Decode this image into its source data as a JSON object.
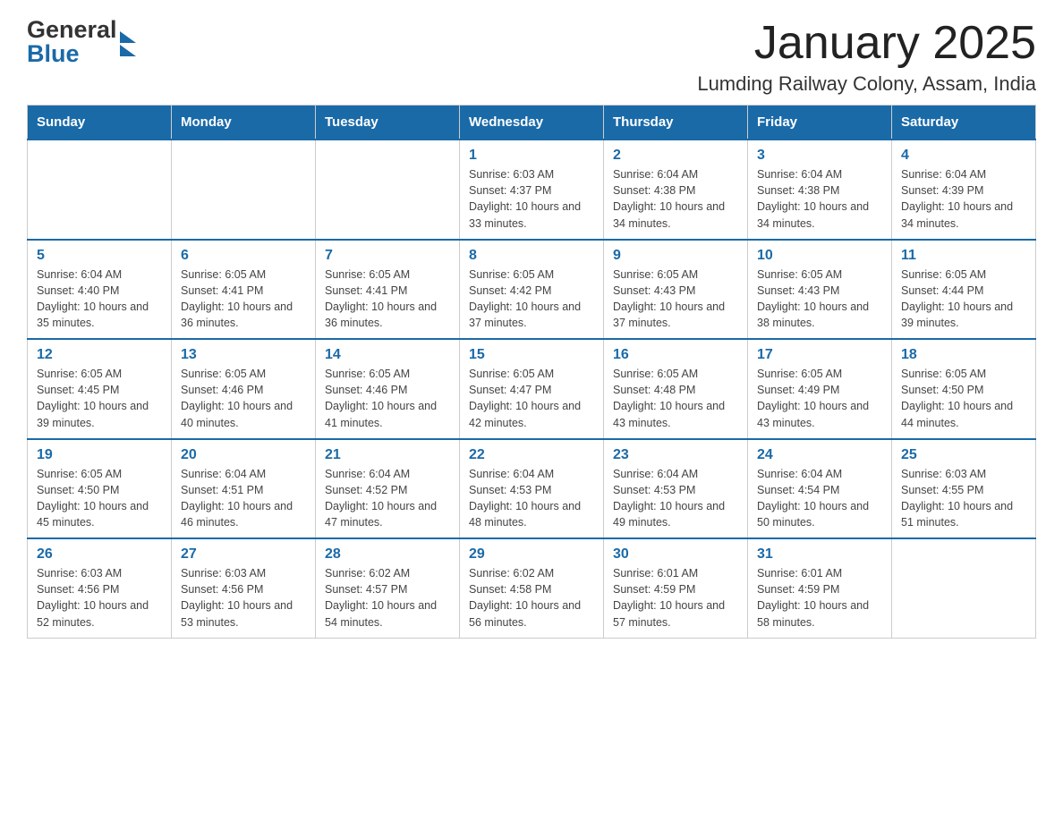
{
  "header": {
    "title": "January 2025",
    "subtitle": "Lumding Railway Colony, Assam, India",
    "logo_general": "General",
    "logo_blue": "Blue"
  },
  "days_of_week": [
    "Sunday",
    "Monday",
    "Tuesday",
    "Wednesday",
    "Thursday",
    "Friday",
    "Saturday"
  ],
  "weeks": [
    [
      {
        "day": "",
        "sunrise": "",
        "sunset": "",
        "daylight": ""
      },
      {
        "day": "",
        "sunrise": "",
        "sunset": "",
        "daylight": ""
      },
      {
        "day": "",
        "sunrise": "",
        "sunset": "",
        "daylight": ""
      },
      {
        "day": "1",
        "sunrise": "Sunrise: 6:03 AM",
        "sunset": "Sunset: 4:37 PM",
        "daylight": "Daylight: 10 hours and 33 minutes."
      },
      {
        "day": "2",
        "sunrise": "Sunrise: 6:04 AM",
        "sunset": "Sunset: 4:38 PM",
        "daylight": "Daylight: 10 hours and 34 minutes."
      },
      {
        "day": "3",
        "sunrise": "Sunrise: 6:04 AM",
        "sunset": "Sunset: 4:38 PM",
        "daylight": "Daylight: 10 hours and 34 minutes."
      },
      {
        "day": "4",
        "sunrise": "Sunrise: 6:04 AM",
        "sunset": "Sunset: 4:39 PM",
        "daylight": "Daylight: 10 hours and 34 minutes."
      }
    ],
    [
      {
        "day": "5",
        "sunrise": "Sunrise: 6:04 AM",
        "sunset": "Sunset: 4:40 PM",
        "daylight": "Daylight: 10 hours and 35 minutes."
      },
      {
        "day": "6",
        "sunrise": "Sunrise: 6:05 AM",
        "sunset": "Sunset: 4:41 PM",
        "daylight": "Daylight: 10 hours and 36 minutes."
      },
      {
        "day": "7",
        "sunrise": "Sunrise: 6:05 AM",
        "sunset": "Sunset: 4:41 PM",
        "daylight": "Daylight: 10 hours and 36 minutes."
      },
      {
        "day": "8",
        "sunrise": "Sunrise: 6:05 AM",
        "sunset": "Sunset: 4:42 PM",
        "daylight": "Daylight: 10 hours and 37 minutes."
      },
      {
        "day": "9",
        "sunrise": "Sunrise: 6:05 AM",
        "sunset": "Sunset: 4:43 PM",
        "daylight": "Daylight: 10 hours and 37 minutes."
      },
      {
        "day": "10",
        "sunrise": "Sunrise: 6:05 AM",
        "sunset": "Sunset: 4:43 PM",
        "daylight": "Daylight: 10 hours and 38 minutes."
      },
      {
        "day": "11",
        "sunrise": "Sunrise: 6:05 AM",
        "sunset": "Sunset: 4:44 PM",
        "daylight": "Daylight: 10 hours and 39 minutes."
      }
    ],
    [
      {
        "day": "12",
        "sunrise": "Sunrise: 6:05 AM",
        "sunset": "Sunset: 4:45 PM",
        "daylight": "Daylight: 10 hours and 39 minutes."
      },
      {
        "day": "13",
        "sunrise": "Sunrise: 6:05 AM",
        "sunset": "Sunset: 4:46 PM",
        "daylight": "Daylight: 10 hours and 40 minutes."
      },
      {
        "day": "14",
        "sunrise": "Sunrise: 6:05 AM",
        "sunset": "Sunset: 4:46 PM",
        "daylight": "Daylight: 10 hours and 41 minutes."
      },
      {
        "day": "15",
        "sunrise": "Sunrise: 6:05 AM",
        "sunset": "Sunset: 4:47 PM",
        "daylight": "Daylight: 10 hours and 42 minutes."
      },
      {
        "day": "16",
        "sunrise": "Sunrise: 6:05 AM",
        "sunset": "Sunset: 4:48 PM",
        "daylight": "Daylight: 10 hours and 43 minutes."
      },
      {
        "day": "17",
        "sunrise": "Sunrise: 6:05 AM",
        "sunset": "Sunset: 4:49 PM",
        "daylight": "Daylight: 10 hours and 43 minutes."
      },
      {
        "day": "18",
        "sunrise": "Sunrise: 6:05 AM",
        "sunset": "Sunset: 4:50 PM",
        "daylight": "Daylight: 10 hours and 44 minutes."
      }
    ],
    [
      {
        "day": "19",
        "sunrise": "Sunrise: 6:05 AM",
        "sunset": "Sunset: 4:50 PM",
        "daylight": "Daylight: 10 hours and 45 minutes."
      },
      {
        "day": "20",
        "sunrise": "Sunrise: 6:04 AM",
        "sunset": "Sunset: 4:51 PM",
        "daylight": "Daylight: 10 hours and 46 minutes."
      },
      {
        "day": "21",
        "sunrise": "Sunrise: 6:04 AM",
        "sunset": "Sunset: 4:52 PM",
        "daylight": "Daylight: 10 hours and 47 minutes."
      },
      {
        "day": "22",
        "sunrise": "Sunrise: 6:04 AM",
        "sunset": "Sunset: 4:53 PM",
        "daylight": "Daylight: 10 hours and 48 minutes."
      },
      {
        "day": "23",
        "sunrise": "Sunrise: 6:04 AM",
        "sunset": "Sunset: 4:53 PM",
        "daylight": "Daylight: 10 hours and 49 minutes."
      },
      {
        "day": "24",
        "sunrise": "Sunrise: 6:04 AM",
        "sunset": "Sunset: 4:54 PM",
        "daylight": "Daylight: 10 hours and 50 minutes."
      },
      {
        "day": "25",
        "sunrise": "Sunrise: 6:03 AM",
        "sunset": "Sunset: 4:55 PM",
        "daylight": "Daylight: 10 hours and 51 minutes."
      }
    ],
    [
      {
        "day": "26",
        "sunrise": "Sunrise: 6:03 AM",
        "sunset": "Sunset: 4:56 PM",
        "daylight": "Daylight: 10 hours and 52 minutes."
      },
      {
        "day": "27",
        "sunrise": "Sunrise: 6:03 AM",
        "sunset": "Sunset: 4:56 PM",
        "daylight": "Daylight: 10 hours and 53 minutes."
      },
      {
        "day": "28",
        "sunrise": "Sunrise: 6:02 AM",
        "sunset": "Sunset: 4:57 PM",
        "daylight": "Daylight: 10 hours and 54 minutes."
      },
      {
        "day": "29",
        "sunrise": "Sunrise: 6:02 AM",
        "sunset": "Sunset: 4:58 PM",
        "daylight": "Daylight: 10 hours and 56 minutes."
      },
      {
        "day": "30",
        "sunrise": "Sunrise: 6:01 AM",
        "sunset": "Sunset: 4:59 PM",
        "daylight": "Daylight: 10 hours and 57 minutes."
      },
      {
        "day": "31",
        "sunrise": "Sunrise: 6:01 AM",
        "sunset": "Sunset: 4:59 PM",
        "daylight": "Daylight: 10 hours and 58 minutes."
      },
      {
        "day": "",
        "sunrise": "",
        "sunset": "",
        "daylight": ""
      }
    ]
  ]
}
